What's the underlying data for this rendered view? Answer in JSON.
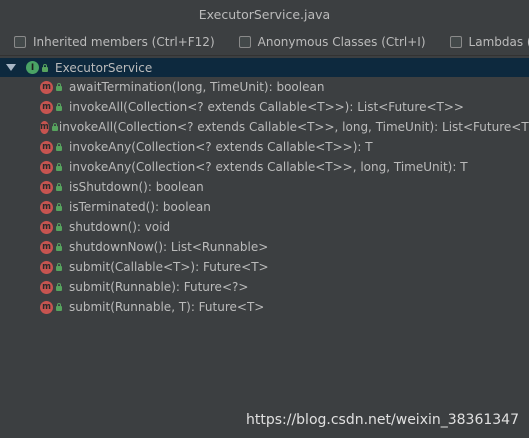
{
  "window": {
    "title": "ExecutorService.java"
  },
  "toolbar": {
    "options": [
      {
        "label": "Inherited members (Ctrl+F12)",
        "checked": false
      },
      {
        "label": "Anonymous Classes (Ctrl+I)",
        "checked": false
      },
      {
        "label": "Lambdas (Ctrl+L)",
        "checked": false
      }
    ],
    "settings_icon": "gear-icon"
  },
  "tree": {
    "root": {
      "icon": "interface-icon",
      "icon_letter": "I",
      "label": "ExecutorService",
      "expanded": true
    },
    "methods": [
      {
        "label": "awaitTermination(long, TimeUnit): boolean"
      },
      {
        "label": "invokeAll(Collection<? extends Callable<T>>): List<Future<T>>"
      },
      {
        "label": "invokeAll(Collection<? extends Callable<T>>, long, TimeUnit): List<Future<T>>"
      },
      {
        "label": "invokeAny(Collection<? extends Callable<T>>): T"
      },
      {
        "label": "invokeAny(Collection<? extends Callable<T>>, long, TimeUnit): T"
      },
      {
        "label": "isShutdown(): boolean"
      },
      {
        "label": "isTerminated(): boolean"
      },
      {
        "label": "shutdown(): void"
      },
      {
        "label": "shutdownNow(): List<Runnable>"
      },
      {
        "label": "submit(Callable<T>): Future<T>"
      },
      {
        "label": "submit(Runnable): Future<?>"
      },
      {
        "label": "submit(Runnable, T): Future<T>"
      }
    ],
    "method_icon_letter": "m"
  },
  "watermark": "https://blog.csdn.net/weixin_38361347",
  "colors": {
    "background": "#3c3f41",
    "selection": "#0d293e",
    "method_icon": "#c75450",
    "interface_icon": "#4aa365",
    "lock": "#57a35e",
    "text": "#bbbbbb"
  }
}
